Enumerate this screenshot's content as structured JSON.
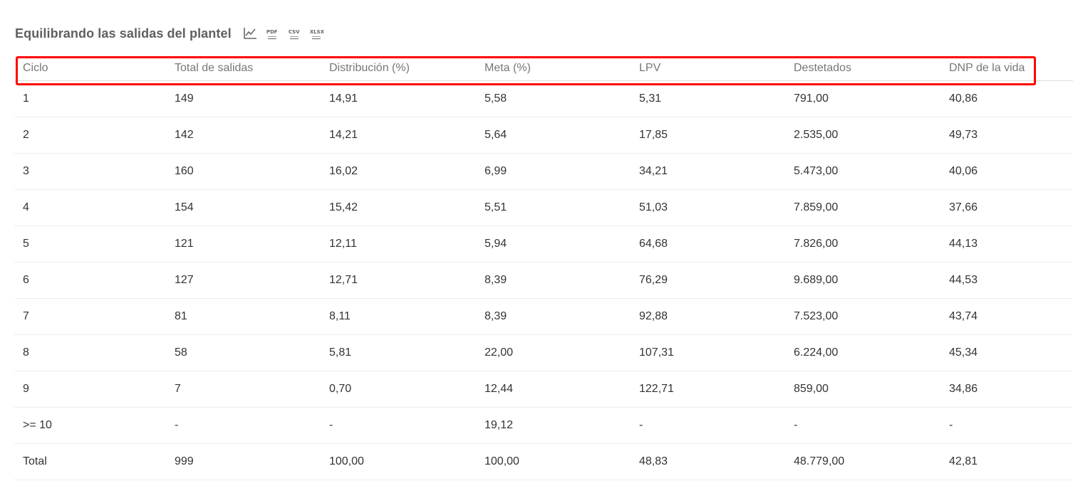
{
  "title": "Equilibrando las salidas del plantel",
  "export_icons": [
    {
      "name": "chart-icon"
    },
    {
      "name": "pdf-icon",
      "label": "PDF"
    },
    {
      "name": "csv-icon",
      "label": "CSV"
    },
    {
      "name": "xlsx-icon",
      "label": "XLSX"
    }
  ],
  "highlight_color": "#ff0000",
  "table": {
    "headers": [
      "Ciclo",
      "Total de salidas",
      "Distribución (%)",
      "Meta (%)",
      "LPV",
      "Destetados",
      "DNP de la vida"
    ],
    "rows": [
      [
        "1",
        "149",
        "14,91",
        "5,58",
        "5,31",
        "791,00",
        "40,86"
      ],
      [
        "2",
        "142",
        "14,21",
        "5,64",
        "17,85",
        "2.535,00",
        "49,73"
      ],
      [
        "3",
        "160",
        "16,02",
        "6,99",
        "34,21",
        "5.473,00",
        "40,06"
      ],
      [
        "4",
        "154",
        "15,42",
        "5,51",
        "51,03",
        "7.859,00",
        "37,66"
      ],
      [
        "5",
        "121",
        "12,11",
        "5,94",
        "64,68",
        "7.826,00",
        "44,13"
      ],
      [
        "6",
        "127",
        "12,71",
        "8,39",
        "76,29",
        "9.689,00",
        "44,53"
      ],
      [
        "7",
        "81",
        "8,11",
        "8,39",
        "92,88",
        "7.523,00",
        "43,74"
      ],
      [
        "8",
        "58",
        "5,81",
        "22,00",
        "107,31",
        "6.224,00",
        "45,34"
      ],
      [
        "9",
        "7",
        "0,70",
        "12,44",
        "122,71",
        "859,00",
        "34,86"
      ],
      [
        ">= 10",
        "-",
        "-",
        "19,12",
        "-",
        "-",
        "-"
      ],
      [
        "Total",
        "999",
        "100,00",
        "100,00",
        "48,83",
        "48.779,00",
        "42,81"
      ]
    ]
  }
}
